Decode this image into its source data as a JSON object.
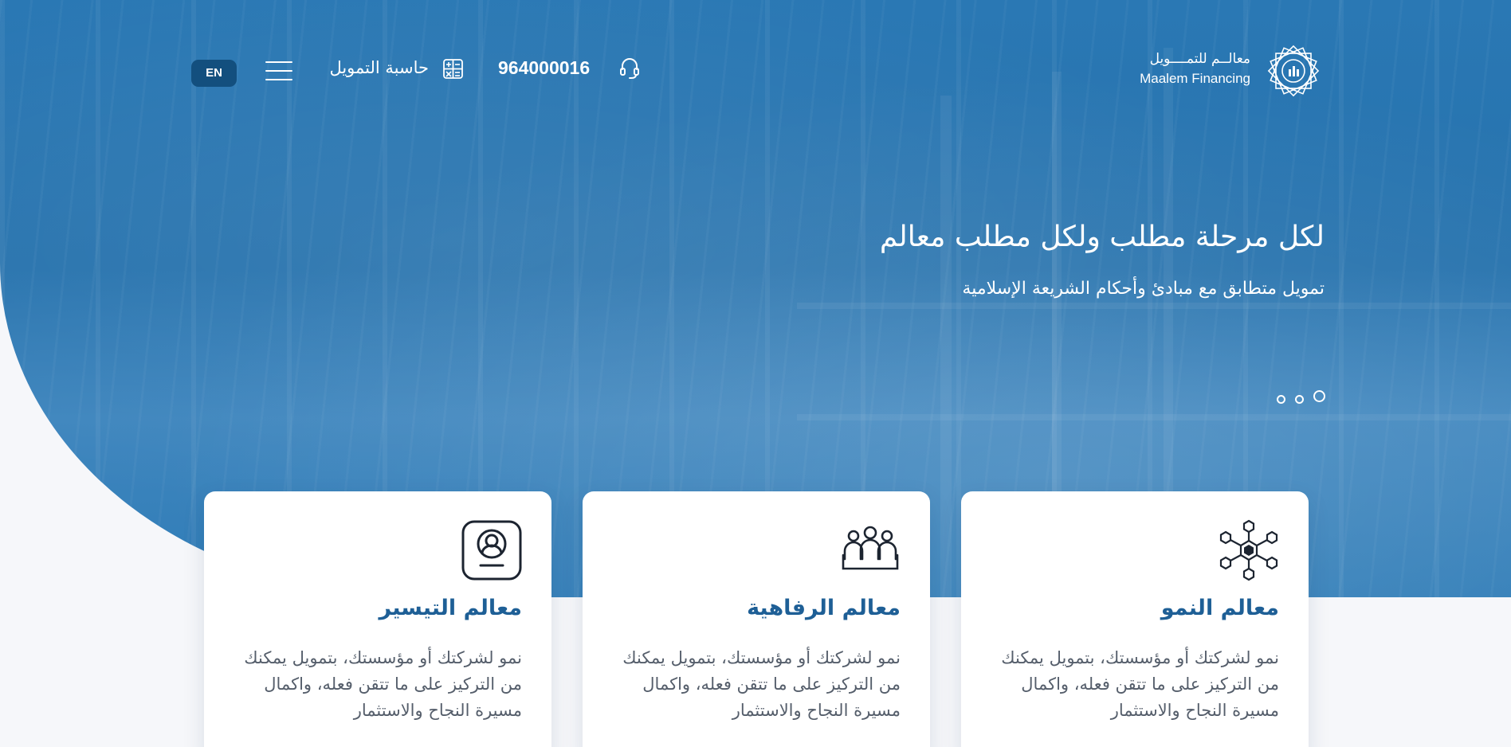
{
  "header": {
    "logo_ar": "معالــم للتمــــويل",
    "logo_en": "Maalem Financing",
    "phone_number": "964000016",
    "calculator_label": "حاسبة التمويل",
    "language_button": "EN",
    "icons": {
      "logo": "maalem-logo-star",
      "phone": "headset-icon",
      "calculator": "calculator-icon",
      "menu": "hamburger-menu-icon"
    }
  },
  "hero": {
    "title": "لكل مرحلة مطلب ولكل مطلب معالم",
    "subtitle": "تمويل متطابق مع مبادئ وأحكام الشريعة الإسلامية",
    "slides_count": 3,
    "active_slide": 1
  },
  "cards": [
    {
      "title": "معالم النمو",
      "description": "نمو لشركتك أو مؤسستك، بتمويل يمكنك من التركيز على ما تتقن فعله، واكمال مسيرة النجاح والاستثمار",
      "icon": "network-hexagon-icon"
    },
    {
      "title": "معالم الرفاهية",
      "description": "نمو لشركتك أو مؤسستك، بتمويل يمكنك من التركيز على ما تتقن فعله، واكمال مسيرة النجاح والاستثمار",
      "icon": "people-group-icon"
    },
    {
      "title": "معالم التيسير",
      "description": "نمو لشركتك أو مؤسستك، بتمويل يمكنك من التركيز على ما تتقن فعله، واكمال مسيرة النجاح والاستثمار",
      "icon": "profile-badge-icon"
    }
  ],
  "colors": {
    "hero_blue": "#2a78b4",
    "lang_button_bg": "#134f7e",
    "card_title": "#1e5f96",
    "card_text": "#555e6b",
    "icon_dark": "#1c2430"
  }
}
